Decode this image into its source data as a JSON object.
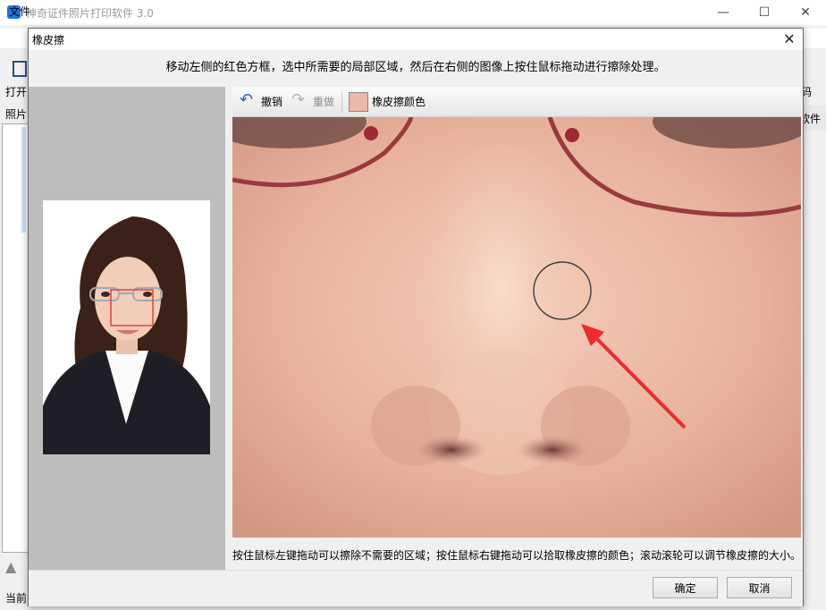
{
  "app": {
    "title": "神奇证件照片打印软件 3.0",
    "menu_file": "文件",
    "toolbar_open": "打开",
    "photo_label": "照片",
    "status_label": "当前",
    "right_code": "码",
    "right_file": "软件",
    "window_controls": {
      "minimize": "—",
      "maximize": "☐",
      "close": "✕"
    }
  },
  "dialog": {
    "title": "橡皮擦",
    "instruction": "移动左侧的红色方框，选中所需要的局部区域，然后在右侧的图像上按住鼠标拖动进行擦除处理。",
    "toolbar": {
      "undo": "撤销",
      "redo": "重做",
      "eraser_color": "橡皮擦颜色"
    },
    "eraser_color_hex": "#edb8a6",
    "hint": "按住鼠标左键拖动可以擦除不需要的区域；按住鼠标右键拖动可以拾取橡皮擦的颜色；滚动滚轮可以调节橡皮擦的大小。",
    "ok": "确定",
    "cancel": "取消",
    "close_icon": "✕"
  },
  "icons": {
    "undo": "undo-arrow-icon",
    "redo": "redo-arrow-icon",
    "close": "close-icon"
  }
}
